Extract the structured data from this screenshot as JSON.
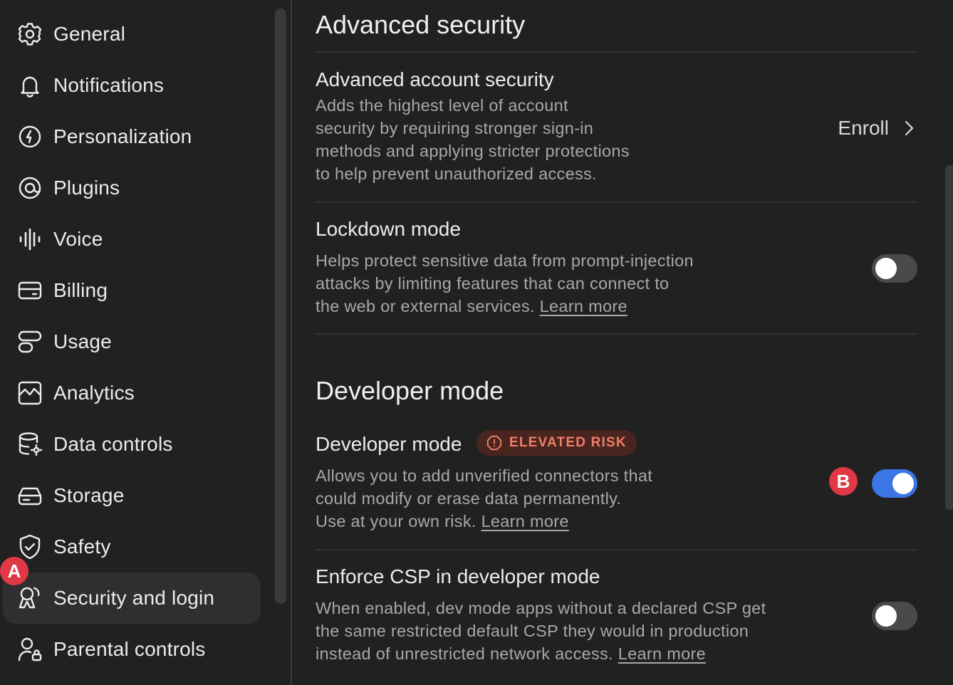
{
  "sidebar": {
    "items": [
      {
        "label": "General",
        "icon": "gear-icon"
      },
      {
        "label": "Notifications",
        "icon": "bell-icon"
      },
      {
        "label": "Personalization",
        "icon": "personalization-icon"
      },
      {
        "label": "Plugins",
        "icon": "plugins-icon"
      },
      {
        "label": "Voice",
        "icon": "waveform-icon"
      },
      {
        "label": "Billing",
        "icon": "credit-card-icon"
      },
      {
        "label": "Usage",
        "icon": "usage-icon"
      },
      {
        "label": "Analytics",
        "icon": "analytics-icon"
      },
      {
        "label": "Data controls",
        "icon": "database-gear-icon"
      },
      {
        "label": "Storage",
        "icon": "storage-drive-icon"
      },
      {
        "label": "Safety",
        "icon": "shield-check-icon"
      },
      {
        "label": "Security and login",
        "icon": "security-login-icon",
        "active": true
      },
      {
        "label": "Parental controls",
        "icon": "parental-lock-icon"
      }
    ]
  },
  "markers": {
    "a": "A",
    "b": "B"
  },
  "advanced_security": {
    "heading": "Advanced security",
    "account": {
      "title": "Advanced account security",
      "desc_lines": [
        "Adds the highest level of account",
        "security by requiring stronger sign-in",
        "methods and applying stricter protections",
        "to help prevent unauthorized access."
      ],
      "action_label": "Enroll"
    },
    "lockdown": {
      "title": "Lockdown mode",
      "desc_lines": [
        "Helps protect sensitive data from prompt-injection",
        "attacks by limiting features that can connect to",
        "the web or external services."
      ],
      "link": "Learn more",
      "enabled": false
    }
  },
  "developer": {
    "heading": "Developer mode",
    "mode": {
      "title": "Developer mode",
      "badge": "ELEVATED RISK",
      "desc_lines": [
        "Allows you to add unverified connectors that",
        "could modify or erase data permanently.",
        "Use at your own risk."
      ],
      "link": "Learn more",
      "enabled": true
    },
    "csp": {
      "title": "Enforce CSP in developer mode",
      "desc_lines": [
        "When enabled, dev mode apps without a declared CSP get",
        "the same restricted default CSP they would in production",
        "instead of unrestricted network access."
      ],
      "link": "Learn more",
      "enabled": false
    }
  },
  "colors": {
    "background": "#212121",
    "accent_toggle": "#3b76e5",
    "risk_text": "#f27e68",
    "marker": "#e03845"
  }
}
